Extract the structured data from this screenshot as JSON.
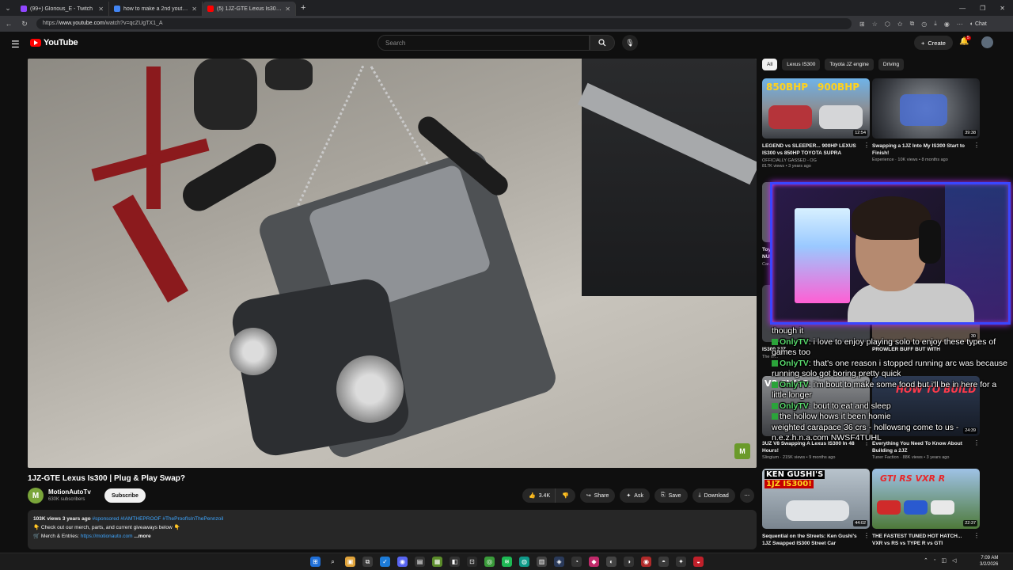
{
  "browser": {
    "tabs": [
      {
        "title": "(99+) Glorious_E - Twitch",
        "color": "#9146ff",
        "active": false
      },
      {
        "title": "how to make a 2nd youtube chan",
        "color": "#4285f4",
        "active": false
      },
      {
        "title": "(5) 1JZ-GTE Lexus Is300 | Plu",
        "color": "#ff0000",
        "active": true
      }
    ],
    "url_prefix": "https://",
    "url_host": "www.youtube.com",
    "url_path": "/watch?v=qcZUgTX1_A",
    "chat_label": "Chat"
  },
  "youtube": {
    "logo": "YouTube",
    "search_placeholder": "Search",
    "create_label": "Create",
    "notification_count": "5"
  },
  "video": {
    "title": "1JZ-GTE Lexus Is300 | Plug & Play Swap?",
    "channel": "MotionAutoTv",
    "subscribers": "630K subscribers",
    "subscribe_label": "Subscribe",
    "likes": "3.4K",
    "share_label": "Share",
    "ask_label": "Ask",
    "save_label": "Save",
    "download_label": "Download",
    "description": {
      "views": "103K views",
      "age": "3 years ago",
      "tags": "#sponsored #IAMTHEPROOF #TheProofIsInThePennzoil",
      "line2": "👇 Check out our merch, parts, and current giveaways below 👇",
      "line3_prefix": "🛒 Merch & Entries: ",
      "line3_link": "https://motionauto.com",
      "more": "...more"
    }
  },
  "sidebar": {
    "chips": [
      "All",
      "Lexus IS300",
      "Toyota JZ engine",
      "Driving"
    ],
    "videos": [
      {
        "title": "LEGEND vs SLEEPER... 900HP LEXUS IS300 vs 850HP TOYOTA SUPRA",
        "channel": "OFFICIALLY GASSED - OG",
        "stats": "817K views • 3 years ago",
        "duration": "12:54",
        "thumb_text_a": "850BHP",
        "thumb_text_b": "900BHP"
      },
      {
        "title": "Swapping a 1JZ Into My IS300 Start to Finish!",
        "channel": "Experience",
        "stats": "10K views • 8 months ago",
        "duration": "39:38"
      },
      {
        "title": "Toyo... NUM...",
        "channel": "Car...",
        "stats": "",
        "duration": ""
      },
      {
        "title": "IS300 2JZ...",
        "channel": "The M...",
        "stats": "",
        "duration": ""
      },
      {
        "title": "PROWLER BUFF BUT WITH",
        "channel": "",
        "stats": "",
        "duration": "30"
      },
      {
        "title": "3UZ V8 Swapping A Lexus IS300 In 48 Hours!",
        "channel": "Slingium",
        "stats": "215K views • 9 months ago",
        "duration": "",
        "thumb_text_a": "V8 SWAP"
      },
      {
        "title": "Everything You Need To Know About Building a 2JZ",
        "channel": "Tuner Faction",
        "stats": "88K views • 3 years ago",
        "duration": "24:39",
        "thumb_text_a": "HOW TO BUILD"
      },
      {
        "title": "Sequential on the Streets: Ken Gushi's 1JZ Swapped IS300 Street Car",
        "channel": "",
        "stats": "",
        "duration": "44:02",
        "thumb_text_a": "KEN GUSHI'S",
        "thumb_text_b": "1JZ IS300!"
      },
      {
        "title": "THE FASTEST TUNED HOT HATCH... VXR vs RS vs TYPE R vs GTI",
        "channel": "",
        "stats": "",
        "duration": "22:37",
        "thumb_text_a": "GTI RS VXR R"
      }
    ]
  },
  "chat_overlay": {
    "lines": [
      {
        "user": "",
        "text": "though it"
      },
      {
        "user": "OnlyTV",
        "text": "i love to enjoy playing solo to enjoy these types of games too"
      },
      {
        "user": "OnlyTV",
        "text": "that's one reason i stopped running arc was because running solo got boring pretty quick"
      },
      {
        "user": "OnlyTV",
        "text": "i'm bout to make some food but i'll be in here for a little longer"
      },
      {
        "user": "OnlyTV",
        "text": "bout to eat and sleep"
      },
      {
        "user": "",
        "text": "the hollow hows it been homie"
      },
      {
        "user": "",
        "text": "weighted carapace 36 crs - hollowsng come to us - n.e.z.h.n.a.com NWSF4TUHL"
      }
    ]
  },
  "taskbar": {
    "time": "7:09 AM",
    "date": "3/2/2026"
  }
}
